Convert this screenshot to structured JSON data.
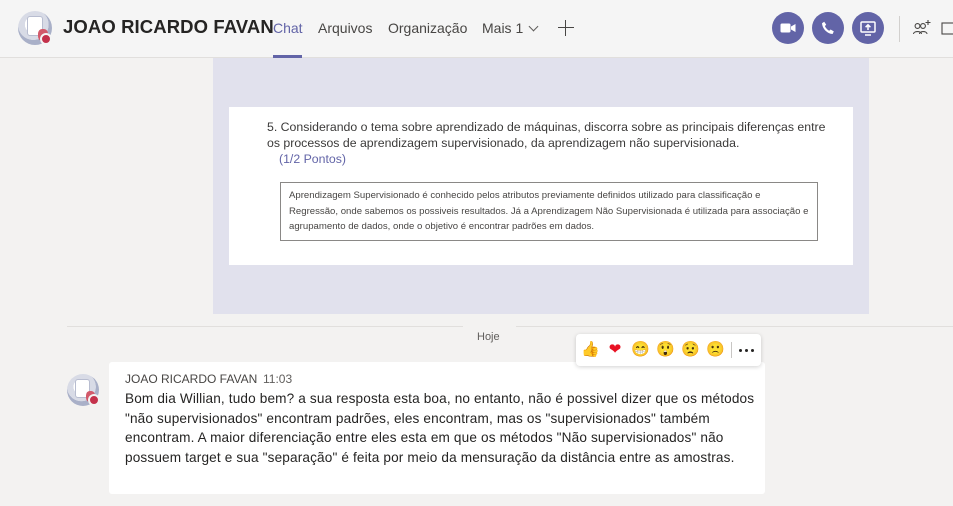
{
  "header": {
    "contact_name": "JOAO RICARDO FAVAN",
    "tabs": [
      {
        "label": "Chat",
        "active": true
      },
      {
        "label": "Arquivos",
        "active": false
      },
      {
        "label": "Organização",
        "active": false
      }
    ],
    "more_label": "Mais 1",
    "icons": {
      "add_tab": "plus-icon",
      "video": "video-camera-icon",
      "audio": "phone-icon",
      "share": "share-screen-icon",
      "people": "add-people-icon",
      "popout": "pop-out-icon"
    },
    "accent_color": "#6264a7",
    "status_color": "#c4314b"
  },
  "image_message": {
    "question": "5. Considerando o tema sobre aprendizado de máquinas, discorra sobre as principais diferenças entre os processos de aprendizagem supervisionado, da aprendizagem não supervisionada.",
    "points": "(1/2 Pontos)",
    "answer": "Aprendizagem Supervisionado é conhecido pelos atributos previamente definidos utilizado para classificação e Regressão, onde sabemos os possiveis resultados. Já a Aprendizagem Não Supervisionada  é utilizada para associação e agrupamento de dados, onde o objetivo é encontrar padrões em dados."
  },
  "date_divider": "Hoje",
  "message": {
    "sender": "JOAO RICARDO FAVAN",
    "time": "11:03",
    "text": "Bom dia Willian, tudo bem? a sua resposta esta boa, no entanto, não é possivel dizer que os métodos \"não supervisionados\" encontram padrões, eles encontram, mas os \"supervisionados\" também encontram. A maior diferenciação entre eles esta em que os métodos \"Não supervisionados\" não possuem target e sua \"separação\" é feita por meio da mensuração da distância entre as amostras."
  },
  "reactions": [
    {
      "name": "like",
      "glyph": "👍"
    },
    {
      "name": "heart",
      "glyph": "❤"
    },
    {
      "name": "laugh",
      "glyph": "😁"
    },
    {
      "name": "surprised",
      "glyph": "😲"
    },
    {
      "name": "sad",
      "glyph": "😟"
    },
    {
      "name": "angry",
      "glyph": "🙁"
    }
  ]
}
